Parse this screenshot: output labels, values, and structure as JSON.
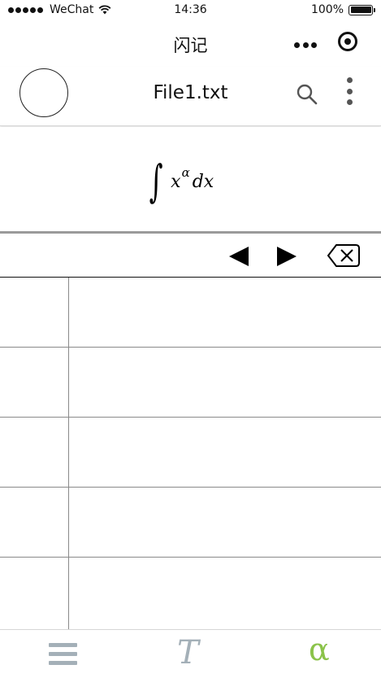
{
  "status_bar": {
    "carrier": "WeChat",
    "time": "14:36",
    "battery": "100%"
  },
  "nav_bar": {
    "title": "闪记"
  },
  "header": {
    "file_name": "File1.txt"
  },
  "formula": {
    "integral": "∫",
    "base": "x",
    "exponent": "α",
    "differential": "dx"
  },
  "tabs": {
    "menu": "menu-icon",
    "text": "T",
    "symbol": "α",
    "active": "symbol"
  },
  "colors": {
    "tab_inactive": "#a4b0b8",
    "tab_active": "#8bc34a"
  },
  "grid": {
    "rows": 5,
    "columns": 2
  }
}
